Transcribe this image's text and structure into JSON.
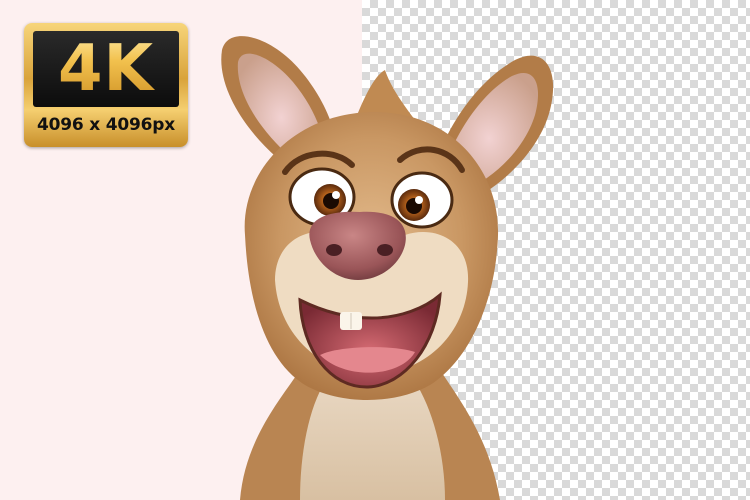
{
  "badge": {
    "title": "4K",
    "resolution": "4096 x 4096px",
    "colors": {
      "gold": "#e3b04b",
      "panel": "#111111"
    }
  },
  "illustration": {
    "subject": "kangaroo-character-icon",
    "background_left": "#fdf0f0",
    "background_right": "transparency-checkerboard"
  }
}
